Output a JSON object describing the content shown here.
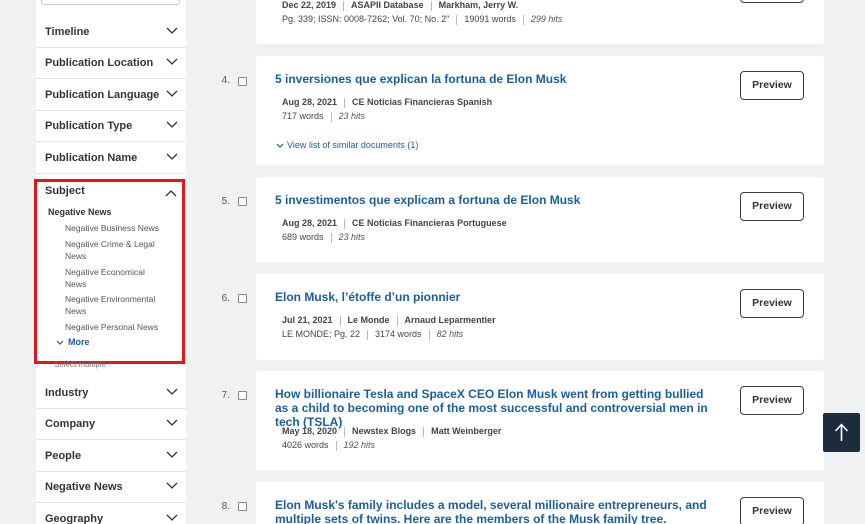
{
  "sidebar": {
    "facets_top": [
      {
        "label": "Timeline"
      },
      {
        "label": "Publication Location"
      },
      {
        "label": "Publication Language"
      },
      {
        "label": "Publication Type"
      },
      {
        "label": "Publication Name"
      }
    ],
    "subject": {
      "label": "Subject",
      "group": "Negative News",
      "items": [
        "Negative Business News",
        "Negative Crime & Legal News",
        "Negative Economical News",
        "Negative Environmental News",
        "Negative Personal News"
      ],
      "more": "More",
      "select_multiple": "Select multiple"
    },
    "facets_bottom": [
      {
        "label": "Industry"
      },
      {
        "label": "Company"
      },
      {
        "label": "People"
      },
      {
        "label": "Negative News"
      },
      {
        "label": "Geography"
      }
    ]
  },
  "results": [
    {
      "number": "",
      "title": "",
      "date": "Dec 22, 2019",
      "source": "ASAPII Database",
      "author": "Markham, Jerry W.",
      "extra": "Pg. 339; ISSN: 0008-7262; Vol. 70; No. 2\"",
      "words": "19091 words",
      "hits": "299 hits"
    },
    {
      "number": "4.",
      "title": "5 inversiones que explican la fortuna de Elon Musk",
      "date": "Aug 28, 2021",
      "source": "CE Noticias Financieras Spanish",
      "words": "717 words",
      "hits": "23 hits",
      "similar": "View list of similar documents (1)",
      "preview": "Preview"
    },
    {
      "number": "5.",
      "title": "5 investimentos que explicam a fortuna de Elon Musk",
      "date": "Aug 28, 2021",
      "source": "CE Noticias Financieras Portuguese",
      "words": "689 words",
      "hits": "23 hits",
      "preview": "Preview"
    },
    {
      "number": "6.",
      "title": "Elon Musk, l’étoffe d’un pionnier",
      "date": "Jul 21, 2021",
      "source": "Le Monde",
      "author": "Arnaud Leparmentier",
      "extra": "LE MONDE; Pg. 22",
      "words": "3174 words",
      "hits": "82 hits",
      "preview": "Preview"
    },
    {
      "number": "7.",
      "title": "How billionaire Tesla and SpaceX CEO Elon Musk went from getting bullied as a child to becoming one of the most successful and controversial men in tech (TSLA)",
      "date": "May 18, 2020",
      "source": "Newstex Blogs",
      "author": "Matt Weinberger",
      "words": "4026 words",
      "hits": "192 hits",
      "preview": "Preview"
    },
    {
      "number": "8.",
      "title": "Elon Musk's family includes a model, several millionaire entrepreneurs, and multiple sets of twins. Here are the members of the Musk family tree.",
      "preview": "Preview"
    }
  ],
  "scroll_top": {
    "icon": "arrow-up-icon"
  },
  "colors": {
    "link": "#1a5f9b",
    "highlight": "#e0161b",
    "scroll_button": "#1c2c3c"
  }
}
